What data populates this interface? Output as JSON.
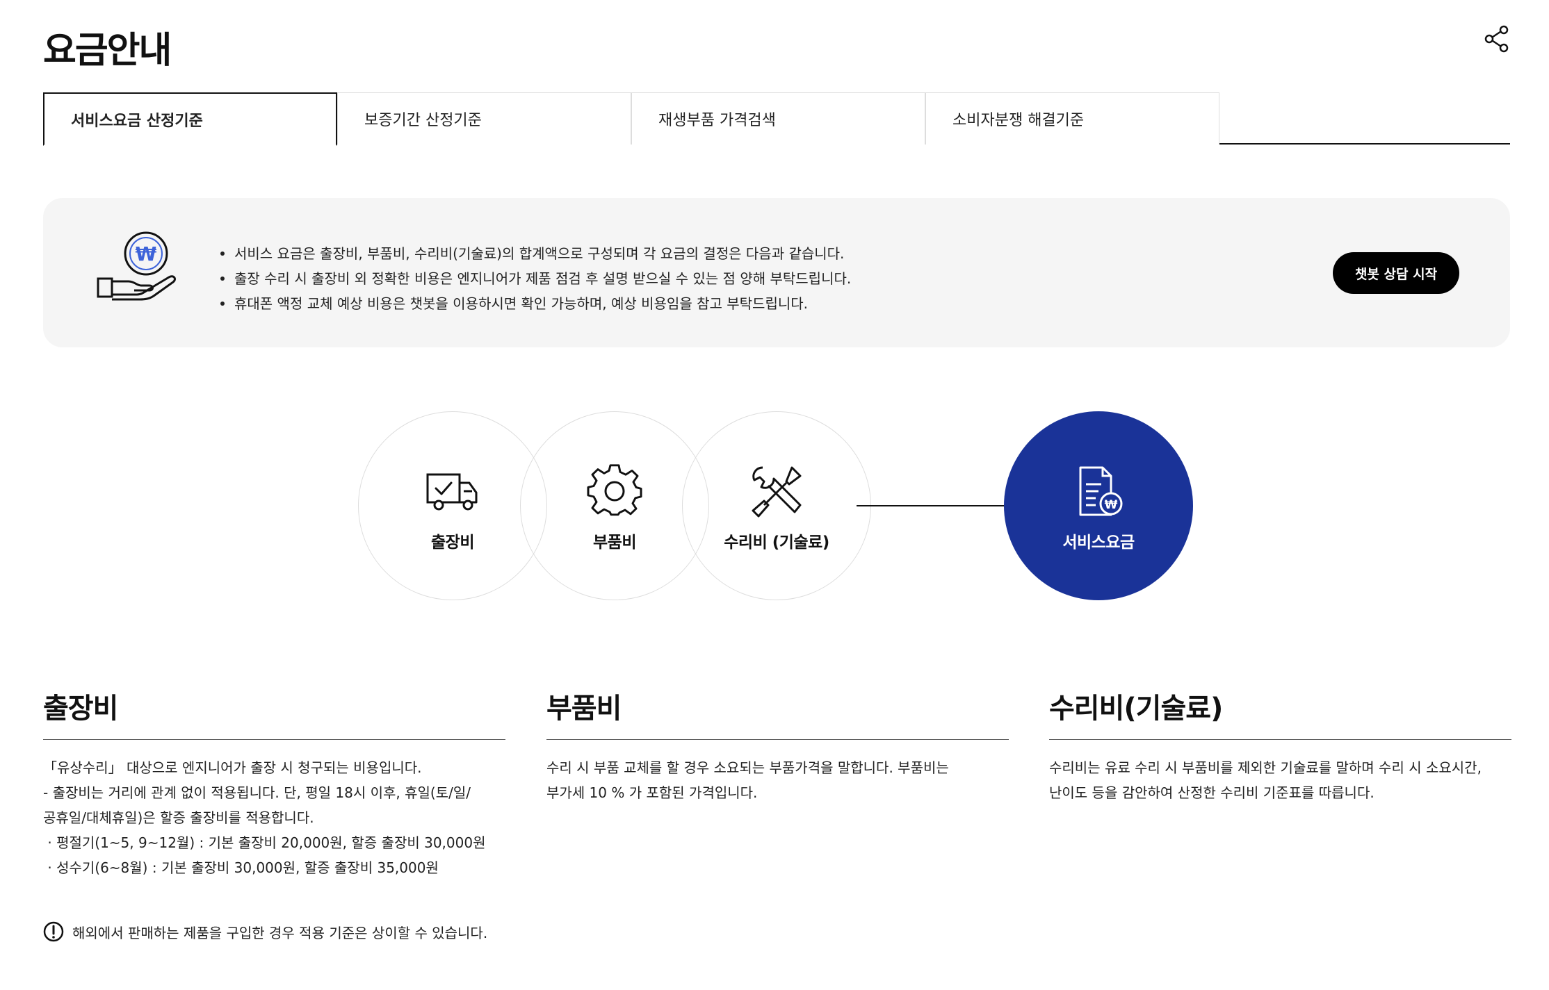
{
  "page": {
    "title": "요금안내"
  },
  "tabs": [
    {
      "label": "서비스요금 산정기준",
      "active": true
    },
    {
      "label": "보증기간 산정기준",
      "active": false
    },
    {
      "label": "재생부품 가격검색",
      "active": false
    },
    {
      "label": "소비자분쟁 해결기준",
      "active": false
    }
  ],
  "info": {
    "items": [
      "서비스 요금은 출장비, 부품비, 수리비(기술료)의 합계액으로 구성되며 각 요금의 결정은 다음과 같습니다.",
      "출장 수리 시 출장비 외 정확한 비용은 엔지니어가 제품 점검 후 설명 받으실 수 있는 점 양해 부탁드립니다.",
      "휴대폰 액정 교체 예상 비용은 챗봇을 이용하시면 확인 가능하며, 예상 비용임을 참고 부탁드립니다."
    ],
    "chat_button": "챗봇 상담 시작"
  },
  "diagram": {
    "items": [
      {
        "label": "출장비",
        "icon": "truck-check-icon"
      },
      {
        "label": "부품비",
        "icon": "gear-icon"
      },
      {
        "label": "수리비 (기술료)",
        "icon": "wrench-screwdriver-icon"
      }
    ],
    "total": {
      "label": "서비스요금",
      "icon": "won-document-icon"
    },
    "colors": {
      "total_bg": "#1a3398",
      "circle_border": "#dddddd"
    }
  },
  "columns": [
    {
      "title": "출장비",
      "lines": [
        "「유상수리」 대상으로 엔지니어가 출장 시 청구되는 비용입니다.",
        "- 출장비는 거리에 관계 없이 적용됩니다. 단, 평일 18시 이후, 휴일(토/일/",
        "공휴일/대체휴일)은 할증 출장비를 적용합니다.",
        " · 평절기(1~5, 9~12월) : 기본 출장비 20,000원, 할증 출장비 30,000원",
        " · 성수기(6~8월) : 기본 출장비 30,000원, 할증 출장비 35,000원"
      ]
    },
    {
      "title": "부품비",
      "lines": [
        "수리 시 부품 교체를 할 경우 소요되는 부품가격을 말합니다. 부품비는",
        "부가세 10 % 가 포함된 가격입니다."
      ]
    },
    {
      "title": "수리비(기술료)",
      "lines": [
        "수리비는 유료 수리 시 부품비를 제외한 기술료를 말하며 수리 시 소요시간,",
        "난이도 등을 감안하여 산정한 수리비 기준표를 따릅니다."
      ]
    }
  ],
  "notice": "해외에서 판매하는 제품을 구입한 경우 적용 기준은 상이할 수 있습니다."
}
